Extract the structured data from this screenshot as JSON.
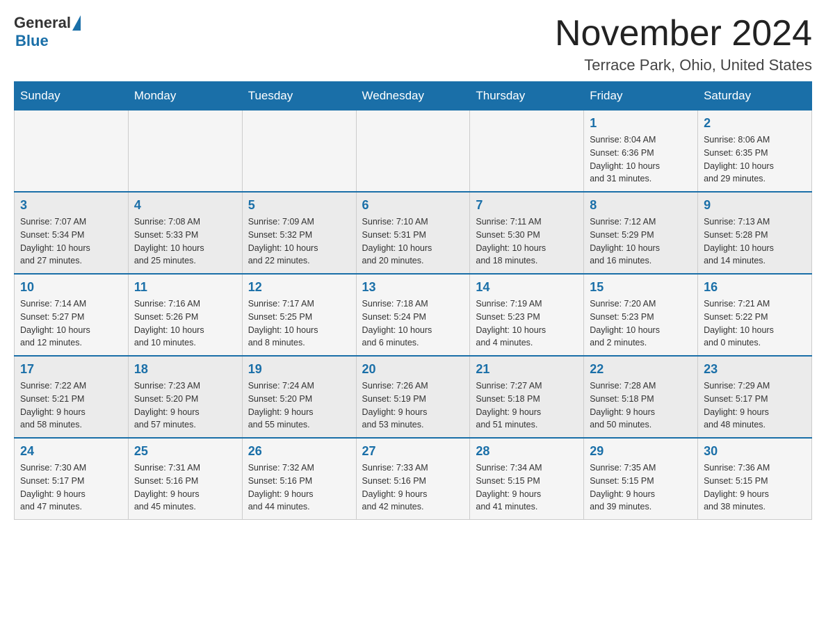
{
  "header": {
    "logo_general": "General",
    "logo_blue": "Blue",
    "month_title": "November 2024",
    "location": "Terrace Park, Ohio, United States"
  },
  "weekdays": [
    "Sunday",
    "Monday",
    "Tuesday",
    "Wednesday",
    "Thursday",
    "Friday",
    "Saturday"
  ],
  "weeks": [
    {
      "days": [
        {
          "number": "",
          "info": ""
        },
        {
          "number": "",
          "info": ""
        },
        {
          "number": "",
          "info": ""
        },
        {
          "number": "",
          "info": ""
        },
        {
          "number": "",
          "info": ""
        },
        {
          "number": "1",
          "info": "Sunrise: 8:04 AM\nSunset: 6:36 PM\nDaylight: 10 hours\nand 31 minutes."
        },
        {
          "number": "2",
          "info": "Sunrise: 8:06 AM\nSunset: 6:35 PM\nDaylight: 10 hours\nand 29 minutes."
        }
      ]
    },
    {
      "days": [
        {
          "number": "3",
          "info": "Sunrise: 7:07 AM\nSunset: 5:34 PM\nDaylight: 10 hours\nand 27 minutes."
        },
        {
          "number": "4",
          "info": "Sunrise: 7:08 AM\nSunset: 5:33 PM\nDaylight: 10 hours\nand 25 minutes."
        },
        {
          "number": "5",
          "info": "Sunrise: 7:09 AM\nSunset: 5:32 PM\nDaylight: 10 hours\nand 22 minutes."
        },
        {
          "number": "6",
          "info": "Sunrise: 7:10 AM\nSunset: 5:31 PM\nDaylight: 10 hours\nand 20 minutes."
        },
        {
          "number": "7",
          "info": "Sunrise: 7:11 AM\nSunset: 5:30 PM\nDaylight: 10 hours\nand 18 minutes."
        },
        {
          "number": "8",
          "info": "Sunrise: 7:12 AM\nSunset: 5:29 PM\nDaylight: 10 hours\nand 16 minutes."
        },
        {
          "number": "9",
          "info": "Sunrise: 7:13 AM\nSunset: 5:28 PM\nDaylight: 10 hours\nand 14 minutes."
        }
      ]
    },
    {
      "days": [
        {
          "number": "10",
          "info": "Sunrise: 7:14 AM\nSunset: 5:27 PM\nDaylight: 10 hours\nand 12 minutes."
        },
        {
          "number": "11",
          "info": "Sunrise: 7:16 AM\nSunset: 5:26 PM\nDaylight: 10 hours\nand 10 minutes."
        },
        {
          "number": "12",
          "info": "Sunrise: 7:17 AM\nSunset: 5:25 PM\nDaylight: 10 hours\nand 8 minutes."
        },
        {
          "number": "13",
          "info": "Sunrise: 7:18 AM\nSunset: 5:24 PM\nDaylight: 10 hours\nand 6 minutes."
        },
        {
          "number": "14",
          "info": "Sunrise: 7:19 AM\nSunset: 5:23 PM\nDaylight: 10 hours\nand 4 minutes."
        },
        {
          "number": "15",
          "info": "Sunrise: 7:20 AM\nSunset: 5:23 PM\nDaylight: 10 hours\nand 2 minutes."
        },
        {
          "number": "16",
          "info": "Sunrise: 7:21 AM\nSunset: 5:22 PM\nDaylight: 10 hours\nand 0 minutes."
        }
      ]
    },
    {
      "days": [
        {
          "number": "17",
          "info": "Sunrise: 7:22 AM\nSunset: 5:21 PM\nDaylight: 9 hours\nand 58 minutes."
        },
        {
          "number": "18",
          "info": "Sunrise: 7:23 AM\nSunset: 5:20 PM\nDaylight: 9 hours\nand 57 minutes."
        },
        {
          "number": "19",
          "info": "Sunrise: 7:24 AM\nSunset: 5:20 PM\nDaylight: 9 hours\nand 55 minutes."
        },
        {
          "number": "20",
          "info": "Sunrise: 7:26 AM\nSunset: 5:19 PM\nDaylight: 9 hours\nand 53 minutes."
        },
        {
          "number": "21",
          "info": "Sunrise: 7:27 AM\nSunset: 5:18 PM\nDaylight: 9 hours\nand 51 minutes."
        },
        {
          "number": "22",
          "info": "Sunrise: 7:28 AM\nSunset: 5:18 PM\nDaylight: 9 hours\nand 50 minutes."
        },
        {
          "number": "23",
          "info": "Sunrise: 7:29 AM\nSunset: 5:17 PM\nDaylight: 9 hours\nand 48 minutes."
        }
      ]
    },
    {
      "days": [
        {
          "number": "24",
          "info": "Sunrise: 7:30 AM\nSunset: 5:17 PM\nDaylight: 9 hours\nand 47 minutes."
        },
        {
          "number": "25",
          "info": "Sunrise: 7:31 AM\nSunset: 5:16 PM\nDaylight: 9 hours\nand 45 minutes."
        },
        {
          "number": "26",
          "info": "Sunrise: 7:32 AM\nSunset: 5:16 PM\nDaylight: 9 hours\nand 44 minutes."
        },
        {
          "number": "27",
          "info": "Sunrise: 7:33 AM\nSunset: 5:16 PM\nDaylight: 9 hours\nand 42 minutes."
        },
        {
          "number": "28",
          "info": "Sunrise: 7:34 AM\nSunset: 5:15 PM\nDaylight: 9 hours\nand 41 minutes."
        },
        {
          "number": "29",
          "info": "Sunrise: 7:35 AM\nSunset: 5:15 PM\nDaylight: 9 hours\nand 39 minutes."
        },
        {
          "number": "30",
          "info": "Sunrise: 7:36 AM\nSunset: 5:15 PM\nDaylight: 9 hours\nand 38 minutes."
        }
      ]
    }
  ]
}
